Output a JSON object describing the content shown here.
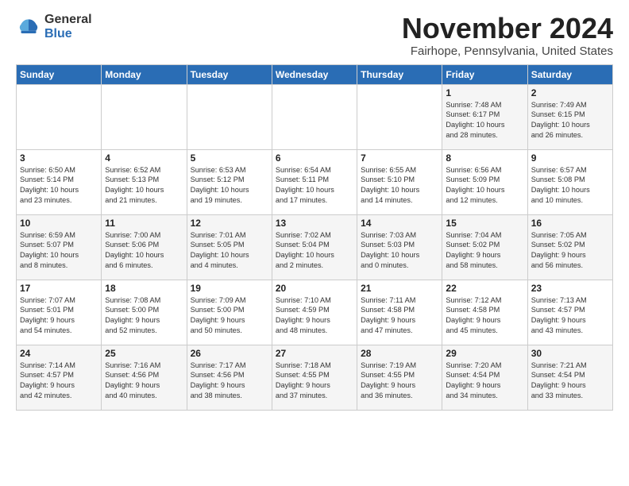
{
  "logo": {
    "general": "General",
    "blue": "Blue"
  },
  "title": "November 2024",
  "location": "Fairhope, Pennsylvania, United States",
  "days_of_week": [
    "Sunday",
    "Monday",
    "Tuesday",
    "Wednesday",
    "Thursday",
    "Friday",
    "Saturday"
  ],
  "weeks": [
    [
      {
        "day": "",
        "info": ""
      },
      {
        "day": "",
        "info": ""
      },
      {
        "day": "",
        "info": ""
      },
      {
        "day": "",
        "info": ""
      },
      {
        "day": "",
        "info": ""
      },
      {
        "day": "1",
        "info": "Sunrise: 7:48 AM\nSunset: 6:17 PM\nDaylight: 10 hours\nand 28 minutes."
      },
      {
        "day": "2",
        "info": "Sunrise: 7:49 AM\nSunset: 6:15 PM\nDaylight: 10 hours\nand 26 minutes."
      }
    ],
    [
      {
        "day": "3",
        "info": "Sunrise: 6:50 AM\nSunset: 5:14 PM\nDaylight: 10 hours\nand 23 minutes."
      },
      {
        "day": "4",
        "info": "Sunrise: 6:52 AM\nSunset: 5:13 PM\nDaylight: 10 hours\nand 21 minutes."
      },
      {
        "day": "5",
        "info": "Sunrise: 6:53 AM\nSunset: 5:12 PM\nDaylight: 10 hours\nand 19 minutes."
      },
      {
        "day": "6",
        "info": "Sunrise: 6:54 AM\nSunset: 5:11 PM\nDaylight: 10 hours\nand 17 minutes."
      },
      {
        "day": "7",
        "info": "Sunrise: 6:55 AM\nSunset: 5:10 PM\nDaylight: 10 hours\nand 14 minutes."
      },
      {
        "day": "8",
        "info": "Sunrise: 6:56 AM\nSunset: 5:09 PM\nDaylight: 10 hours\nand 12 minutes."
      },
      {
        "day": "9",
        "info": "Sunrise: 6:57 AM\nSunset: 5:08 PM\nDaylight: 10 hours\nand 10 minutes."
      }
    ],
    [
      {
        "day": "10",
        "info": "Sunrise: 6:59 AM\nSunset: 5:07 PM\nDaylight: 10 hours\nand 8 minutes."
      },
      {
        "day": "11",
        "info": "Sunrise: 7:00 AM\nSunset: 5:06 PM\nDaylight: 10 hours\nand 6 minutes."
      },
      {
        "day": "12",
        "info": "Sunrise: 7:01 AM\nSunset: 5:05 PM\nDaylight: 10 hours\nand 4 minutes."
      },
      {
        "day": "13",
        "info": "Sunrise: 7:02 AM\nSunset: 5:04 PM\nDaylight: 10 hours\nand 2 minutes."
      },
      {
        "day": "14",
        "info": "Sunrise: 7:03 AM\nSunset: 5:03 PM\nDaylight: 10 hours\nand 0 minutes."
      },
      {
        "day": "15",
        "info": "Sunrise: 7:04 AM\nSunset: 5:02 PM\nDaylight: 9 hours\nand 58 minutes."
      },
      {
        "day": "16",
        "info": "Sunrise: 7:05 AM\nSunset: 5:02 PM\nDaylight: 9 hours\nand 56 minutes."
      }
    ],
    [
      {
        "day": "17",
        "info": "Sunrise: 7:07 AM\nSunset: 5:01 PM\nDaylight: 9 hours\nand 54 minutes."
      },
      {
        "day": "18",
        "info": "Sunrise: 7:08 AM\nSunset: 5:00 PM\nDaylight: 9 hours\nand 52 minutes."
      },
      {
        "day": "19",
        "info": "Sunrise: 7:09 AM\nSunset: 5:00 PM\nDaylight: 9 hours\nand 50 minutes."
      },
      {
        "day": "20",
        "info": "Sunrise: 7:10 AM\nSunset: 4:59 PM\nDaylight: 9 hours\nand 48 minutes."
      },
      {
        "day": "21",
        "info": "Sunrise: 7:11 AM\nSunset: 4:58 PM\nDaylight: 9 hours\nand 47 minutes."
      },
      {
        "day": "22",
        "info": "Sunrise: 7:12 AM\nSunset: 4:58 PM\nDaylight: 9 hours\nand 45 minutes."
      },
      {
        "day": "23",
        "info": "Sunrise: 7:13 AM\nSunset: 4:57 PM\nDaylight: 9 hours\nand 43 minutes."
      }
    ],
    [
      {
        "day": "24",
        "info": "Sunrise: 7:14 AM\nSunset: 4:57 PM\nDaylight: 9 hours\nand 42 minutes."
      },
      {
        "day": "25",
        "info": "Sunrise: 7:16 AM\nSunset: 4:56 PM\nDaylight: 9 hours\nand 40 minutes."
      },
      {
        "day": "26",
        "info": "Sunrise: 7:17 AM\nSunset: 4:56 PM\nDaylight: 9 hours\nand 38 minutes."
      },
      {
        "day": "27",
        "info": "Sunrise: 7:18 AM\nSunset: 4:55 PM\nDaylight: 9 hours\nand 37 minutes."
      },
      {
        "day": "28",
        "info": "Sunrise: 7:19 AM\nSunset: 4:55 PM\nDaylight: 9 hours\nand 36 minutes."
      },
      {
        "day": "29",
        "info": "Sunrise: 7:20 AM\nSunset: 4:54 PM\nDaylight: 9 hours\nand 34 minutes."
      },
      {
        "day": "30",
        "info": "Sunrise: 7:21 AM\nSunset: 4:54 PM\nDaylight: 9 hours\nand 33 minutes."
      }
    ]
  ]
}
